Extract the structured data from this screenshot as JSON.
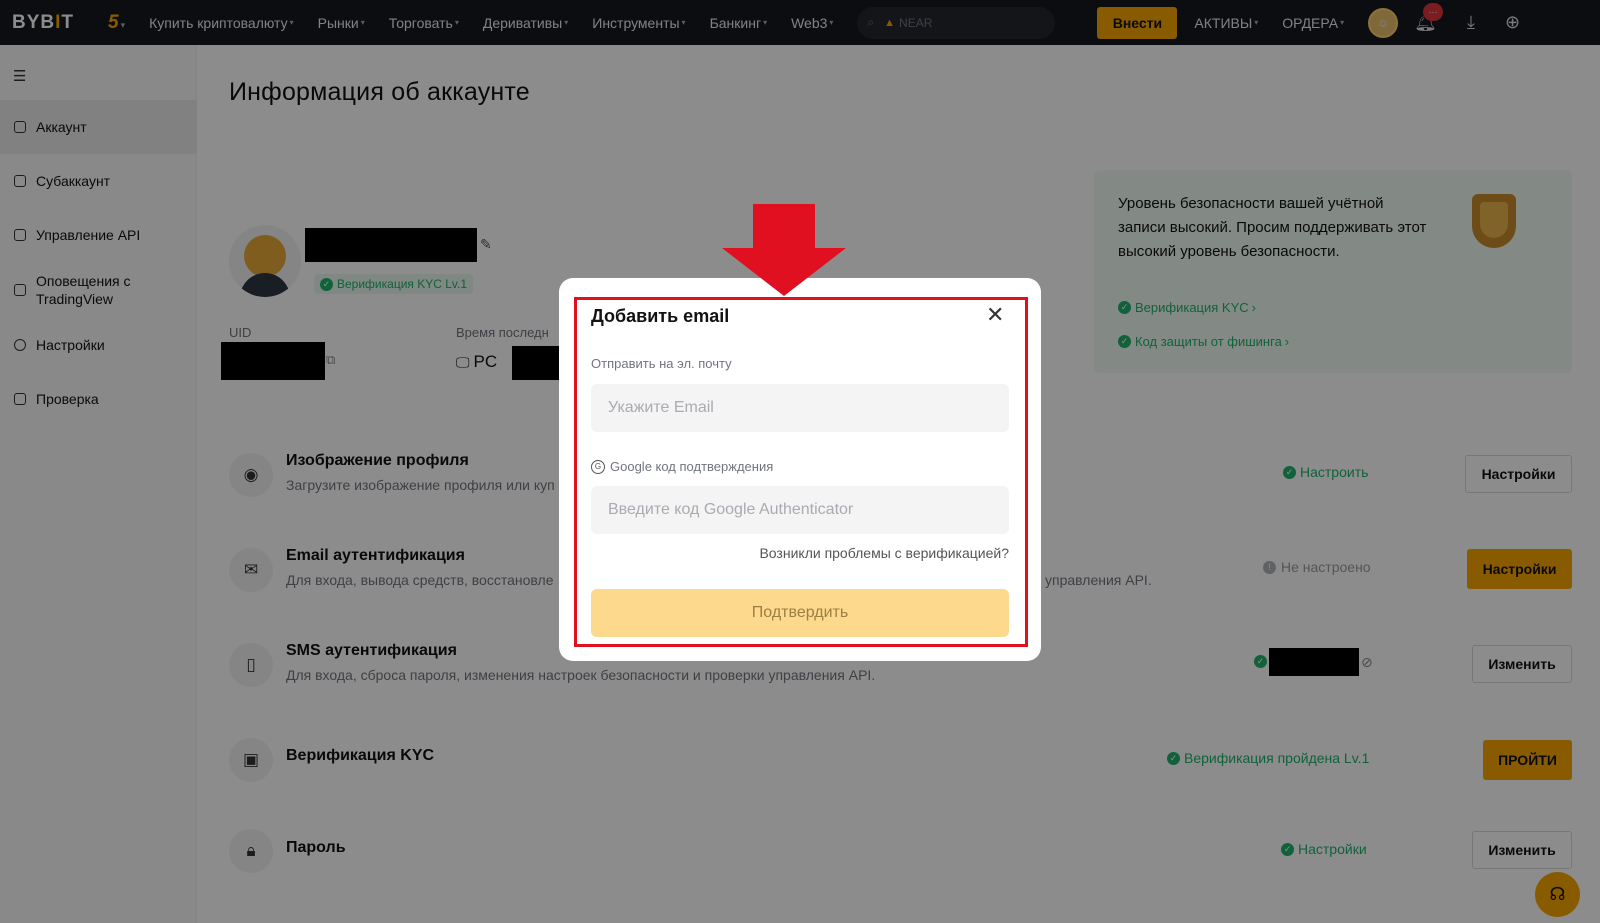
{
  "nav": {
    "logo_main": "BYB",
    "logo_bar": "I",
    "logo_end": "T",
    "five_badge": "5",
    "items": [
      "Купить криптовалюту",
      "Рынки",
      "Торговать",
      "Деривативы",
      "Инструменты",
      "Банкинг",
      "Web3"
    ],
    "search_placeholder": "NEAR",
    "deposit_label": "Внести",
    "assets_label": "АКТИВЫ",
    "orders_label": "ОРДЕРА",
    "notification_badge": "···"
  },
  "sidebar": {
    "items": [
      {
        "label": "Аккаунт",
        "active": true
      },
      {
        "label": "Субаккаунт"
      },
      {
        "label": "Управление API"
      },
      {
        "label": "Оповещения с TradingView"
      },
      {
        "label": "Настройки"
      },
      {
        "label": "Проверка"
      }
    ]
  },
  "page": {
    "title": "Информация об аккаунте",
    "kyc_tag": "Верификация KYC Lv.1",
    "uid_label": "UID",
    "last_login_label": "Время последн",
    "device": "PC"
  },
  "security_card": {
    "text": "Уровень безопасности вашей учётной записи высокий. Просим поддерживать этот высокий уровень безопасности.",
    "link_kyc": "Верификация KYC",
    "link_phishing": "Код защиты от фишинга"
  },
  "rows": [
    {
      "title": "Изображение профиля",
      "desc": "Загрузите изображение профиля или куп",
      "status": "Настроить",
      "action": "Настройки"
    },
    {
      "title": "Email аутентификация",
      "desc": "Для входа, вывода средств, восстановле",
      "desc_tail": "управления API.",
      "status": "Не настроено",
      "action": "Настройки"
    },
    {
      "title": "SMS аутентификация",
      "desc": "Для входа, сброса пароля, изменения настроек безопасности и проверки управления API.",
      "status": "",
      "action": "Изменить"
    },
    {
      "title": "Верификация KYC",
      "desc": "",
      "status": "Верификация пройдена Lv.1",
      "action": "ПРОЙТИ"
    },
    {
      "title": "Пароль",
      "desc": "",
      "status": "Настройки",
      "action": "Изменить"
    }
  ],
  "modal": {
    "title": "Добавить email",
    "email_label": "Отправить на эл. почту",
    "email_placeholder": "Укажите Email",
    "google_label": "Google код подтверждения",
    "google_placeholder": "Введите код Google Authenticator",
    "trouble_link": "Возникли проблемы с верификацией?",
    "confirm_label": "Подтвердить"
  },
  "colors": {
    "brand": "#f7a600",
    "success": "#20b26c",
    "annotation_red": "#e01020",
    "nav_bg": "#17181e"
  }
}
